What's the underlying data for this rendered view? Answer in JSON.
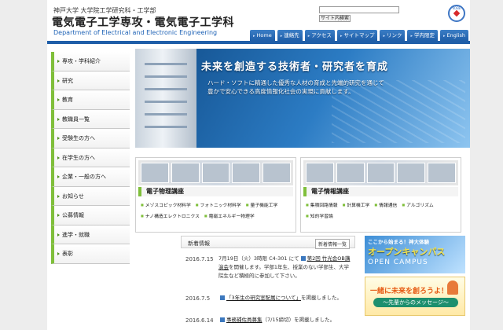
{
  "header": {
    "university": "神戸大学 大学院工学研究科・工学部",
    "title": "電気電子工学専攻・電気電子工学科",
    "subtitle": "Department of Electrical and Electronic Engineering",
    "search_button": "サイト内検索",
    "logo_text": "KOBE"
  },
  "topnav": [
    "Home",
    "連絡先",
    "アクセス",
    "サイトマップ",
    "リンク",
    "学内限定",
    "English"
  ],
  "sidebar": [
    "専攻・学科紹介",
    "研究",
    "教育",
    "教職員一覧",
    "受験生の方へ",
    "在学生の方へ",
    "企業・一般の方へ",
    "お知らせ",
    "公募情報",
    "進学・就職",
    "表彰"
  ],
  "hero": {
    "heading": "未来を創造する技術者・研究者を育成",
    "line1": "ハード・ソフトに精通した優秀な人材の育成と先端的研究を通じて",
    "line2": "豊かで安心できる高度情報化社会の実現に貢献します。"
  },
  "departments": [
    {
      "title": "電子物理講座",
      "links": [
        "メゾスコピック材料学",
        "フォトニック材料学",
        "量子機能工学",
        "ナノ構造エレクトロニクス",
        "電磁エネルギー物理学"
      ]
    },
    {
      "title": "電子情報講座",
      "links": [
        "集積回路情報",
        "計算機工学",
        "情報通信",
        "アルゴリズム",
        "知的学習論"
      ]
    }
  ],
  "news": {
    "heading": "新着情報",
    "more": "新着情報一覧",
    "items": [
      {
        "date": "2016.7.15",
        "prefix": "7月19日（火）3時限 C4-301 にて",
        "link": "第2回 竹光会OB講演会",
        "suffix": "を開催します。学部1年生、授業のない学部生、大学院生など積極的に参加して下さい。"
      },
      {
        "date": "2016.7.5",
        "prefix": "",
        "link": "「3年生の研究室配属について」",
        "suffix": "を掲載しました。"
      },
      {
        "date": "2016.6.14",
        "prefix": "",
        "link": "事務補佐員募集",
        "suffix": "（7/15締切）を掲載しました。"
      }
    ]
  },
  "banners": {
    "open_campus": {
      "line1": "ここから始まる！神大体験",
      "line2": "オープンキャンパス",
      "line3": "OPEN CAMPUS"
    },
    "message": {
      "line1": "一緒に未来を創ろうよ！",
      "line2": "～先輩からのメッセージ～"
    }
  },
  "colors": {
    "accent_green": "#7fbf3a",
    "nav_blue": "#1f5ea8",
    "hero_blue": "#2c7cc4"
  }
}
